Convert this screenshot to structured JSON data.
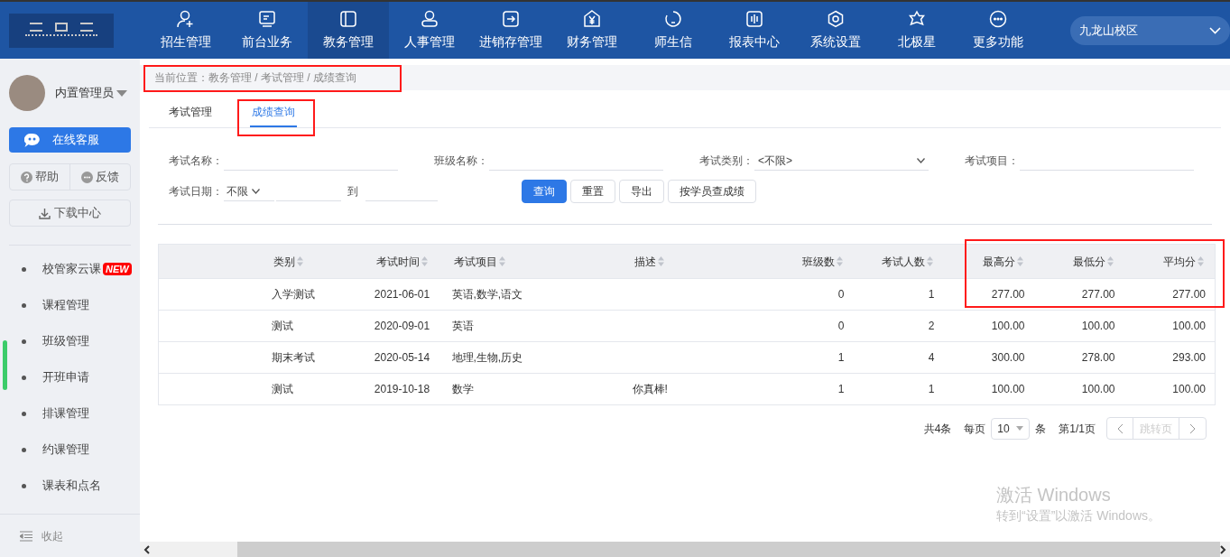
{
  "nav": {
    "items": [
      {
        "label": "招生管理",
        "selected": false
      },
      {
        "label": "前台业务",
        "selected": false
      },
      {
        "label": "教务管理",
        "selected": true
      },
      {
        "label": "人事管理",
        "selected": false
      },
      {
        "label": "进销存管理",
        "selected": false
      },
      {
        "label": "财务管理",
        "selected": false
      },
      {
        "label": "师生信",
        "selected": false
      },
      {
        "label": "报表中心",
        "selected": false
      },
      {
        "label": "系统设置",
        "selected": false
      },
      {
        "label": "北极星",
        "selected": false
      },
      {
        "label": "更多功能",
        "selected": false
      }
    ],
    "campus": "九龙山校区"
  },
  "sidebar": {
    "user": "内置管理员",
    "service": "在线客服",
    "help": "帮助",
    "feedback": "反馈",
    "download": "下载中心",
    "items": [
      {
        "label": "校管家云课",
        "badge": "NEW"
      },
      {
        "label": "课程管理"
      },
      {
        "label": "班级管理"
      },
      {
        "label": "开班申请"
      },
      {
        "label": "排课管理"
      },
      {
        "label": "约课管理"
      },
      {
        "label": "课表和点名"
      }
    ],
    "collapse": "收起"
  },
  "breadcrumb": "当前位置：教务管理 / 考试管理 / 成绩查询",
  "tabs": [
    {
      "label": "考试管理",
      "selected": false
    },
    {
      "label": "成绩查询",
      "selected": true
    }
  ],
  "filters": [
    {
      "label": "考试名称：",
      "kind": "text"
    },
    {
      "label": "班级名称：",
      "kind": "text"
    },
    {
      "label": "考试类别：",
      "kind": "select",
      "value": "<不限>"
    },
    {
      "label": "考试项目：",
      "kind": "text"
    }
  ],
  "date_filter": {
    "label": "考试日期：",
    "range": "不限",
    "to": "到"
  },
  "buttons": [
    {
      "label": "查询",
      "primary": true
    },
    {
      "label": "重置",
      "primary": false
    },
    {
      "label": "导出",
      "primary": false
    },
    {
      "label": "按学员查成绩",
      "primary": false
    }
  ],
  "table": {
    "columns": [
      "类别",
      "考试时间",
      "考试项目",
      "描述",
      "班级数",
      "考试人数",
      "最高分",
      "最低分",
      "平均分"
    ],
    "rows": [
      [
        "入学测试",
        "2021-06-01",
        "英语,数学,语文",
        null,
        "0",
        "1",
        "277.00",
        "277.00",
        "277.00"
      ],
      [
        "测试",
        "2020-09-01",
        "英语",
        null,
        "0",
        "2",
        "100.00",
        "100.00",
        "100.00"
      ],
      [
        "期末考试",
        "2020-05-14",
        "地理,生物,历史",
        null,
        "1",
        "4",
        "300.00",
        "278.00",
        "293.00"
      ],
      [
        "测试",
        "2019-10-18",
        "数学",
        "你真棒!",
        "1",
        "1",
        "100.00",
        "100.00",
        "100.00"
      ]
    ]
  },
  "pagination": {
    "total": "共4条",
    "per_page": "每页",
    "page_size": "10",
    "unit": "条",
    "page": "第1/1页",
    "jump": "跳转页"
  },
  "os_notice": {
    "title": "激活 Windows",
    "text": "转到“设置”以激活 Windows。"
  }
}
